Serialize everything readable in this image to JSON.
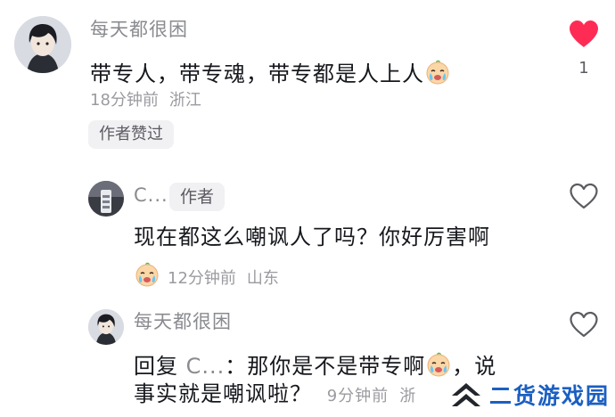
{
  "comment": {
    "username": "每天都很困",
    "text": "带专人，带专魂，带专都是人上人",
    "time": "18分钟前",
    "location": "浙江",
    "badge": "作者赞过",
    "like_count": "1",
    "liked": true
  },
  "reply1": {
    "username": "C...",
    "author_tag": "作者",
    "text": "现在都这么嘲讽人了吗？你好厉害啊",
    "time": "12分钟前",
    "location": "山东"
  },
  "reply2": {
    "username": "每天都很困",
    "reply_prefix": "回复",
    "reply_to": "C...",
    "colon": "：",
    "text_part1": "那你是不是带专啊",
    "text_part2": "，说",
    "text_line2": "事实就是嘲讽啦？",
    "time": "9分钟前",
    "location": "浙"
  },
  "watermark": {
    "text": "二货游戏园"
  },
  "colors": {
    "like_active": "#fe2c55",
    "watermark": "#1b5fc2"
  },
  "icons": {
    "liked": "heart-filled-icon",
    "unliked": "heart-outline-icon",
    "emoji": "crying-face-emoji",
    "watermark_logo": "double-chevron-logo-icon"
  }
}
